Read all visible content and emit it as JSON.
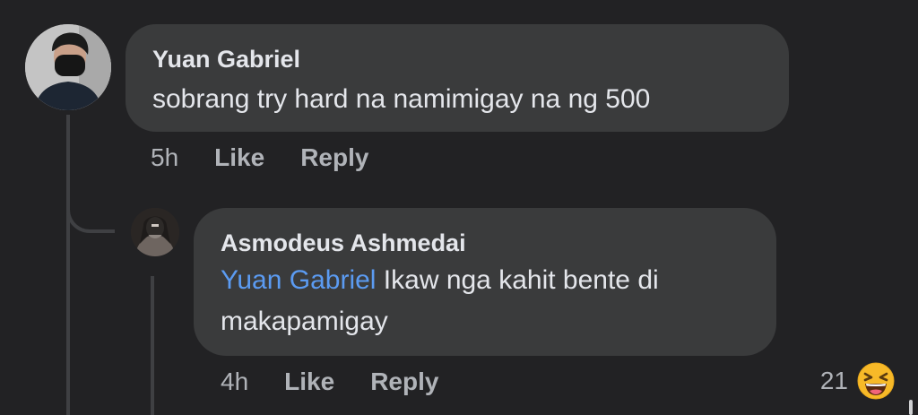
{
  "comments": [
    {
      "author": "Yuan Gabriel",
      "text": "sobrang try hard na namimigay na ng 500",
      "time": "5h",
      "like_label": "Like",
      "reply_label": "Reply"
    }
  ],
  "replies": [
    {
      "author": "Asmodeus Ashmedai",
      "mention": "Yuan Gabriel",
      "text_line1": "Ikaw nga kahit bente di",
      "text_line2": "makapamigay",
      "time": "4h",
      "like_label": "Like",
      "reply_label": "Reply",
      "reaction_count": "21",
      "reaction_icon": "haha-emoji-icon"
    }
  ],
  "colors": {
    "background": "#222224",
    "bubble": "#3a3b3c",
    "text": "#e4e6eb",
    "muted": "#b0b3b8",
    "mention": "#5b9bf2",
    "reaction_yellow": "#f7b928"
  }
}
